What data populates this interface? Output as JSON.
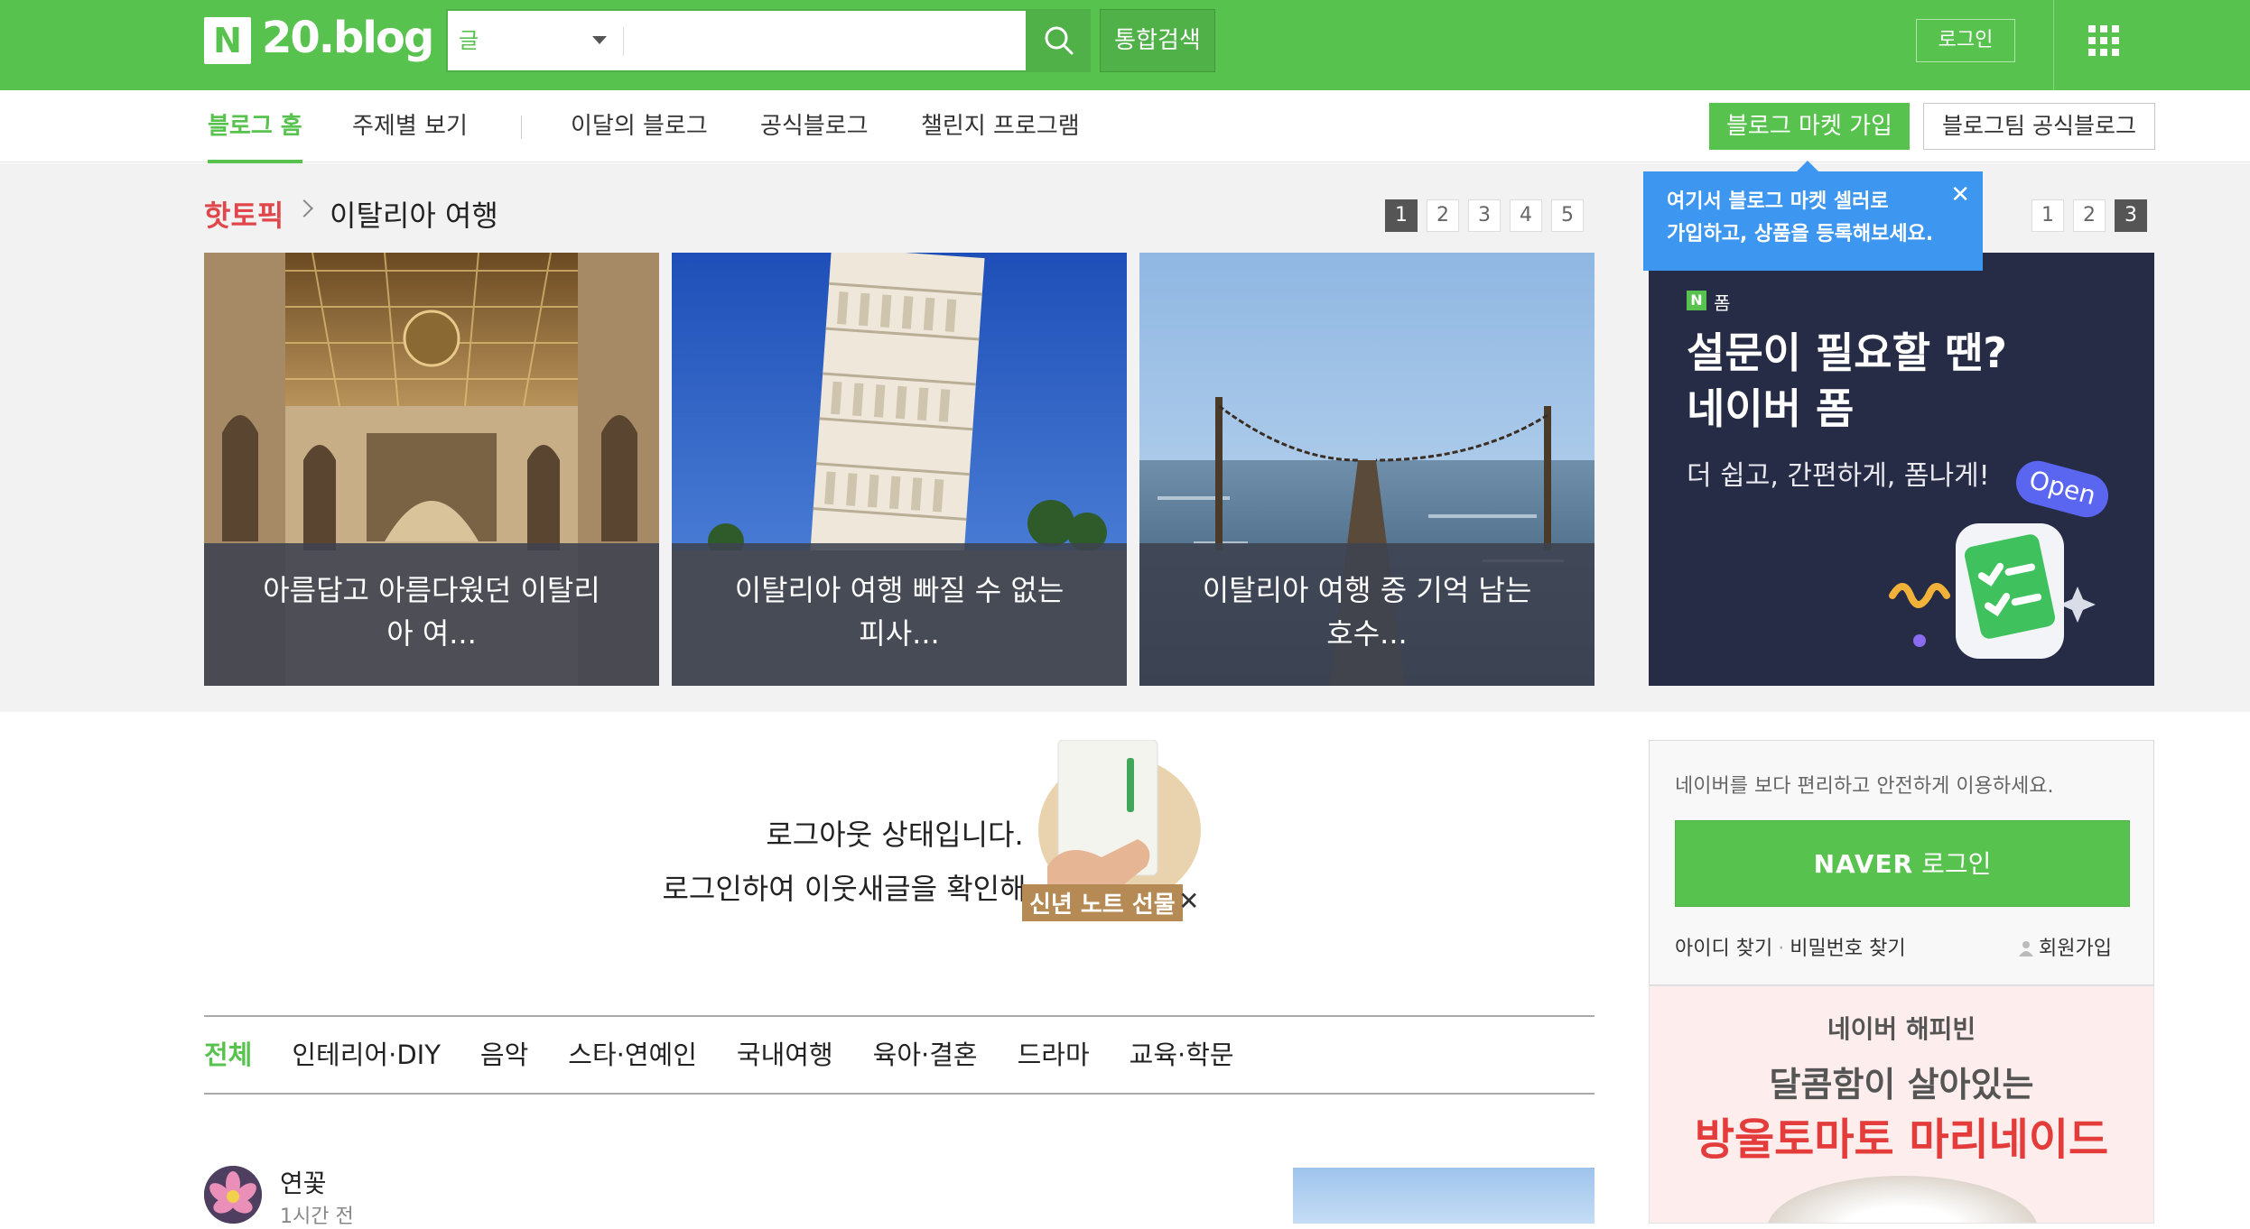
{
  "header": {
    "logo_n": "N",
    "logo_text": "20.blog",
    "search_category": "글",
    "search_value": "",
    "integrated_search": "통합검색",
    "login": "로그인"
  },
  "nav": {
    "items": [
      "블로그 홈",
      "주제별 보기",
      "이달의 블로그",
      "공식블로그",
      "챌린지 프로그램"
    ],
    "market_signup": "블로그 마켓 가입",
    "official_blog": "블로그팀 공식블로그"
  },
  "hot_topic": {
    "label": "핫토픽",
    "title": "이탈리아 여행",
    "pages": [
      "1",
      "2",
      "3",
      "4",
      "5"
    ],
    "active_page": "1",
    "cards": [
      {
        "caption": "아름답고 아름다웠던 이탈리아 여..."
      },
      {
        "caption": "이탈리아 여행 빠질 수 없는 피사..."
      },
      {
        "caption": "이탈리아 여행 중 기억 남는 호수..."
      }
    ]
  },
  "tooltip": {
    "text": "여기서 블로그 마켓 셀러로\n가입하고, 상품을 등록해보세요.",
    "close": "✕"
  },
  "ad_pager": {
    "pages": [
      "1",
      "2",
      "3"
    ],
    "active_page": "3"
  },
  "ad": {
    "brand_n": "N",
    "brand": "폼",
    "headline": "설문이 필요할 땐?\n네이버 폼",
    "sub": "더 쉽고, 간편하게, 폼나게!",
    "badge": "Open"
  },
  "notice": {
    "line1": "로그아웃 상태입니다.",
    "line2": "로그인하여 이웃새글을 확인해",
    "promo_label": "신년 노트 선물",
    "promo_close": "✕"
  },
  "categories": {
    "items": [
      "전체",
      "인테리어·DIY",
      "음악",
      "스타·연예인",
      "국내여행",
      "육아·결혼",
      "드라마",
      "교육·학문"
    ],
    "active": "전체"
  },
  "post": {
    "author": "연꽃",
    "time": "1시간 전"
  },
  "login_box": {
    "message": "네이버를 보다 편리하고 안전하게 이용하세요.",
    "button_brand": "NAVER",
    "button_text": "로그인",
    "find_id": "아이디 찾기",
    "find_pw": "비밀번호 찾기",
    "signup": "회원가입"
  },
  "ad2": {
    "brand": "네이버 해피빈",
    "line1": "달콤함이 살아있는",
    "line2": "방울토마토 마리네이드"
  },
  "colors": {
    "brand_green": "#58c24e",
    "hot_red": "#e0474c",
    "tooltip_blue": "#3d96ef",
    "ad_bg": "#262c45"
  }
}
